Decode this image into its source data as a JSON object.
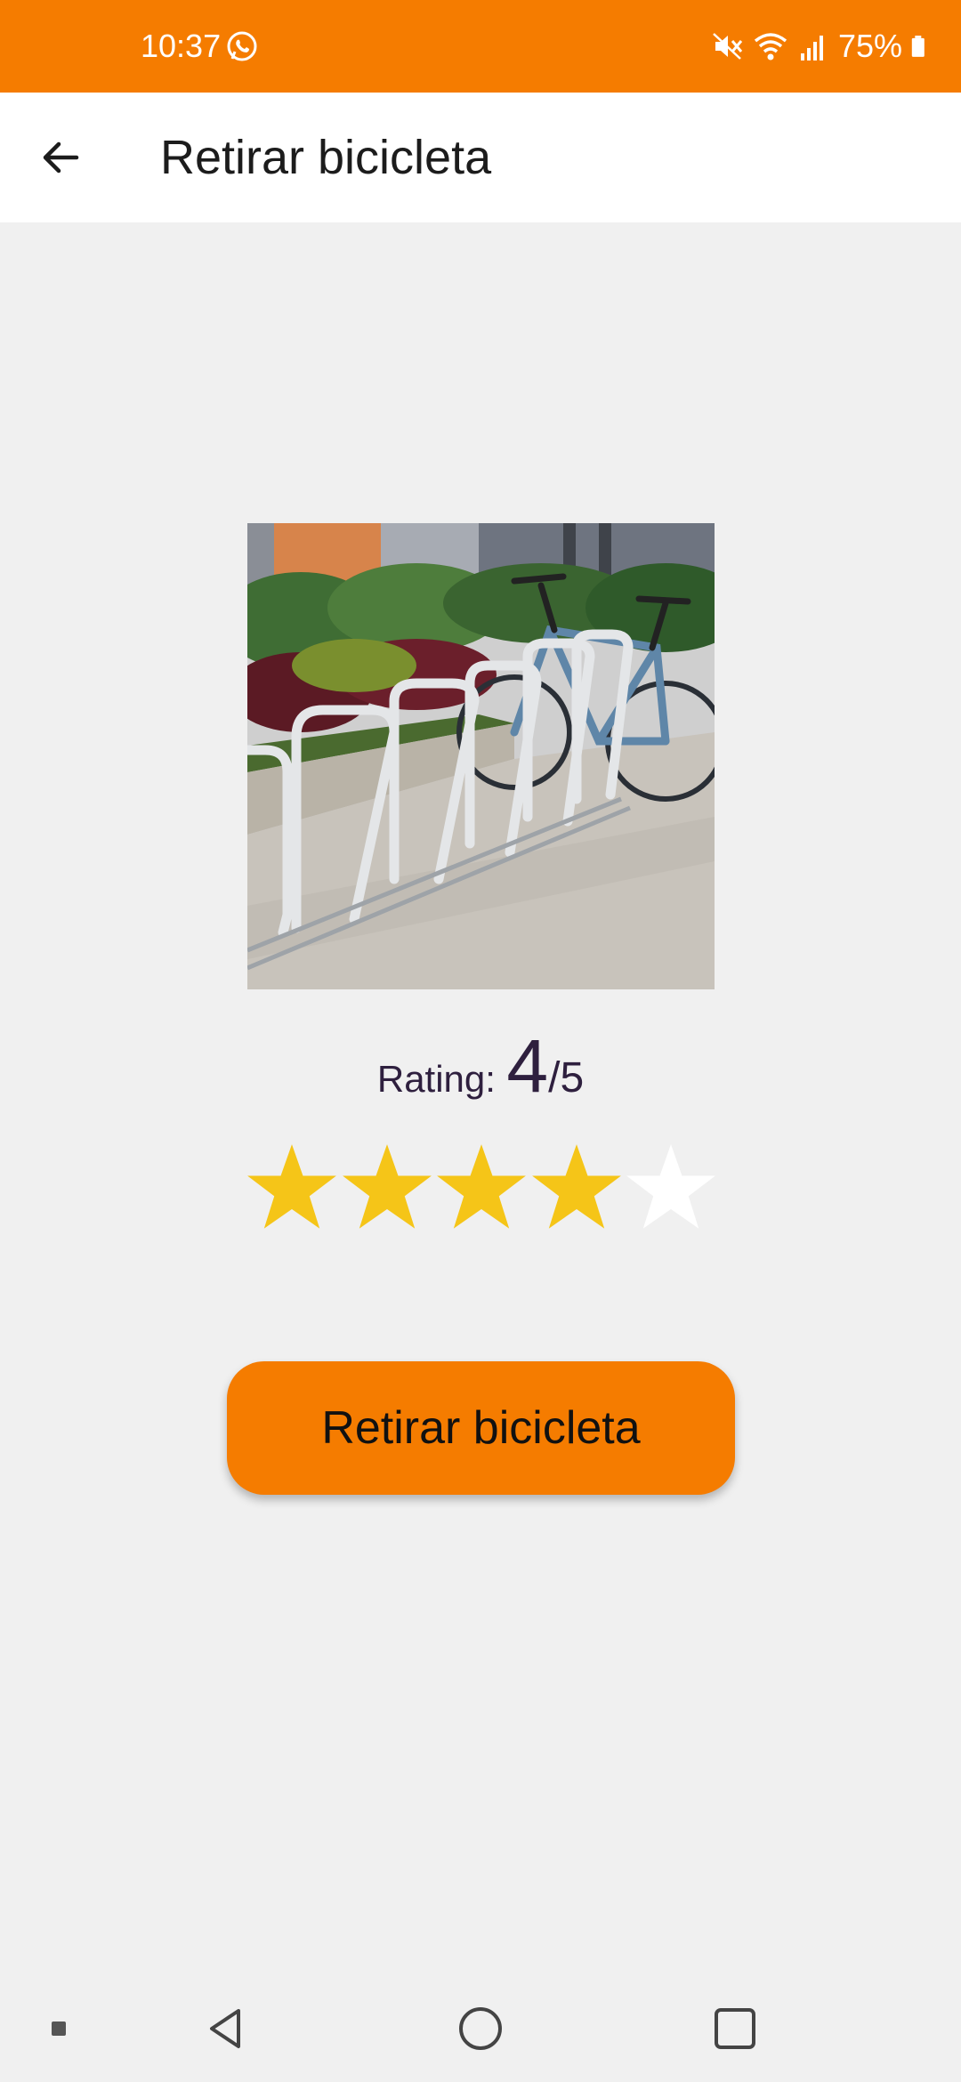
{
  "status_bar": {
    "time": "10:37",
    "battery": "75%",
    "background": "#f57c00",
    "icons": [
      "whatsapp-icon",
      "mute-icon",
      "wifi-icon",
      "signal-icon",
      "battery-icon"
    ]
  },
  "app_bar": {
    "title": "Retirar bicicleta",
    "back_icon": "arrow-left-icon"
  },
  "station": {
    "image": "bike-rack-photo"
  },
  "rating": {
    "label": "Rating:",
    "value": "4",
    "max": "/5",
    "stars_filled": 4,
    "stars_total": 5,
    "filled_color": "#f5c518",
    "empty_color": "#ffffff"
  },
  "action": {
    "button_label": "Retirar bicicleta",
    "color": "#f57c00"
  },
  "nav_bar": {
    "items": [
      "recents-dot-icon",
      "back-triangle-icon",
      "home-circle-icon",
      "overview-square-icon"
    ]
  }
}
